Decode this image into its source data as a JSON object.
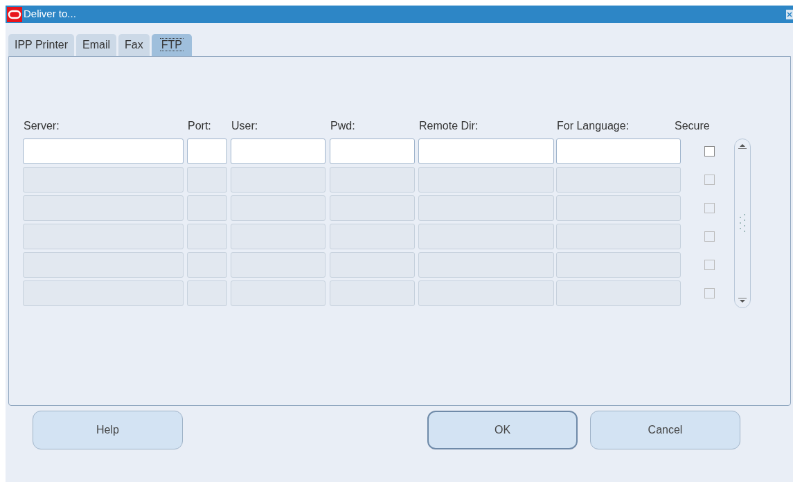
{
  "window": {
    "title": "Deliver to..."
  },
  "tabs": [
    {
      "label": "IPP Printer",
      "selected": false
    },
    {
      "label": "Email",
      "selected": false
    },
    {
      "label": "Fax",
      "selected": false
    },
    {
      "label": "FTP",
      "selected": true
    }
  ],
  "table": {
    "columns": [
      "Server:",
      "Port:",
      "User:",
      "Pwd:",
      "Remote Dir:",
      "For Language:",
      "Secure"
    ],
    "rows": [
      {
        "enabled": true,
        "secure_checked": false
      },
      {
        "enabled": false,
        "secure_checked": false
      },
      {
        "enabled": false,
        "secure_checked": false
      },
      {
        "enabled": false,
        "secure_checked": false
      },
      {
        "enabled": false,
        "secure_checked": false
      },
      {
        "enabled": false,
        "secure_checked": false
      }
    ]
  },
  "buttons": [
    {
      "label": "Help",
      "default": false
    },
    {
      "label": "OK",
      "default": true
    },
    {
      "label": "Cancel",
      "default": false
    }
  ]
}
